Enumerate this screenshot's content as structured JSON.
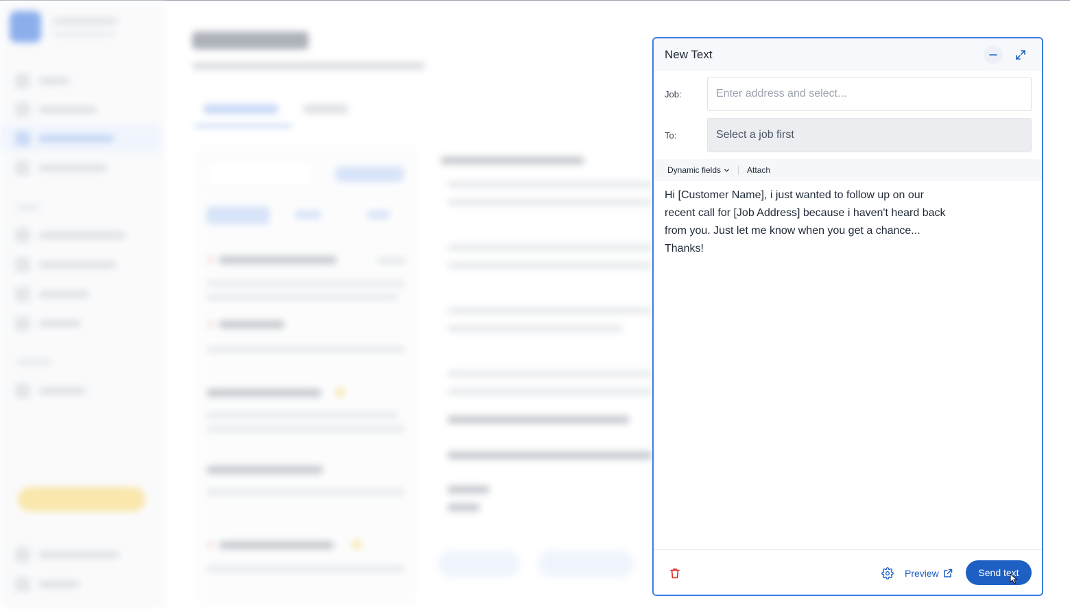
{
  "panel": {
    "title": "New Text"
  },
  "job_field": {
    "label": "Job:",
    "placeholder": "Enter address and select..."
  },
  "to_field": {
    "label": "To:",
    "placeholder": "Select a job first"
  },
  "toolbar": {
    "dynamic_fields_label": "Dynamic fields",
    "attach_label": "Attach"
  },
  "message": {
    "body": "Hi [Customer Name], i just wanted to follow up on our recent call for [Job Address] because i haven't heard back from you. Just let me know when you get a chance... Thanks!"
  },
  "footer": {
    "preview_label": "Preview",
    "send_label": "Send text"
  },
  "colors": {
    "accent": "#1e5fc4",
    "panel_border": "#3b7de2",
    "delete": "#e02424"
  },
  "icons": [
    "minimize-icon",
    "expand-icon",
    "chevron-down-icon",
    "trash-icon",
    "gear-icon",
    "external-link-icon",
    "cursor-icon"
  ]
}
